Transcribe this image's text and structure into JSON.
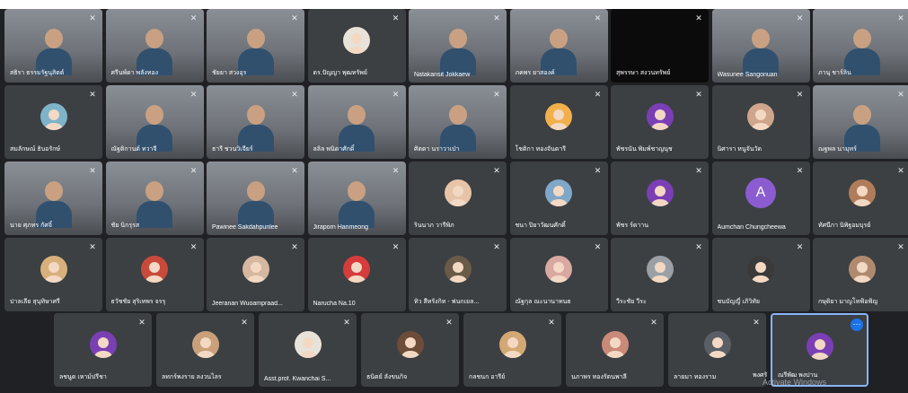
{
  "meeting": {
    "grid_rows": [
      [
        {
          "name": "สธิรา ธรรมรัฐนุสิตต์",
          "type": "video"
        },
        {
          "name": "ศรีนพ์ดา พลังทอง",
          "type": "video"
        },
        {
          "name": "ชัยยา สวงอุร",
          "type": "video"
        },
        {
          "name": "ดร.ปัญญา พุฒทรัพย์",
          "type": "avatar",
          "avatar_color": "#e8e3d8"
        },
        {
          "name": "Natakansit Jokkaew",
          "type": "video"
        },
        {
          "name": "ภคพร ยาสองค์",
          "type": "video"
        },
        {
          "name": "สุพรรษา สงวนทรัพย์",
          "type": "black"
        },
        {
          "name": "Wasunee Sangonuan",
          "type": "video"
        },
        {
          "name": "ภานุ ชาร์ลิน",
          "type": "video"
        }
      ],
      [
        {
          "name": "สมลักษณ์ ธิบอรักษ์",
          "type": "avatar",
          "avatar_color": "#7fb3c8"
        },
        {
          "name": "ณัฐติกานต์ ทวาจี",
          "type": "video"
        },
        {
          "name": "ธารี ชวนวิเจียร์",
          "type": "video"
        },
        {
          "name": "ลลิล พนิดาศักดิ์",
          "type": "video"
        },
        {
          "name": "ศิตดา นราวาเป่า",
          "type": "video"
        },
        {
          "name": "โชติกา ทองจันดารี",
          "type": "avatar",
          "avatar_color": "#f2b04a"
        },
        {
          "name": "พัชรนัน พิมพ์ชาญนุช",
          "type": "avatar",
          "avatar_color": "#7b3fb5"
        },
        {
          "name": "นิศารา หนูจันวัด",
          "type": "avatar",
          "avatar_color": "#cfa58b"
        },
        {
          "name": "ณฐพล นามุทร์",
          "type": "video"
        }
      ],
      [
        {
          "name": "นาย ศุภทร กัศจิ์",
          "type": "video"
        },
        {
          "name": "ชัย นิกรุรส",
          "type": "video"
        },
        {
          "name": "Pawinee Sakdahpunlee",
          "type": "video"
        },
        {
          "name": "Jiraporn Hanmeong",
          "type": "video"
        },
        {
          "name": "รินนาภ วารีพิภ",
          "type": "avatar",
          "avatar_color": "#e7c4a8"
        },
        {
          "name": "ชนา ปิยาวัฒนศักดิ์",
          "type": "avatar",
          "avatar_color": "#7fa7c8"
        },
        {
          "name": "พัชร ร์ดาาน",
          "type": "avatar",
          "avatar_color": "#7b3fb5"
        },
        {
          "name": "Aumchan Chungcheewa",
          "type": "letter",
          "letter": "A",
          "avatar_color": "#8a5cd0"
        },
        {
          "name": "ทัศนีกา นิพิฐอมบุรย์",
          "type": "avatar",
          "avatar_color": "#b07c5a"
        }
      ],
      [
        {
          "name": "ปาลเลีย สุนุทิษาศรี",
          "type": "avatar",
          "avatar_color": "#d8b07c"
        },
        {
          "name": "ธวัชชัย สุริเทพร จรรุ",
          "type": "avatar",
          "avatar_color": "#c94a3a"
        },
        {
          "name": "Jeeranan Wuoampraad...",
          "type": "avatar",
          "avatar_color": "#d6b8a0"
        },
        {
          "name": "Narucha Na.10",
          "type": "avatar",
          "avatar_color": "#d63c3c"
        },
        {
          "name": "ทิว สีทรังกิท - ฟนกเยล...",
          "type": "avatar",
          "avatar_color": "#6a5a48"
        },
        {
          "name": "ณัฐกุล ณะนานาทนธ",
          "type": "avatar",
          "avatar_color": "#d9a8a0"
        },
        {
          "name": "วีระชัย วีระ",
          "type": "avatar",
          "avatar_color": "#9aa0a6"
        },
        {
          "name": "ชนบัญญี่ เภิวิทัย",
          "type": "avatar",
          "avatar_color": "#3a3a3a"
        },
        {
          "name": "กษุดิยา มาญโหฟ้อฟ้ญ",
          "type": "avatar",
          "avatar_color": "#b08a6e"
        }
      ]
    ],
    "bottom_row": [
      {
        "name": "ลชนูด เหาม์ปรีชา",
        "type": "avatar",
        "avatar_color": "#7b3fb5"
      },
      {
        "name": "ลทกร์พงราย ลงวนไลร",
        "type": "avatar",
        "avatar_color": "#c9a07a"
      },
      {
        "name": "Asst.prof. Kwanchai S...",
        "type": "avatar",
        "avatar_color": "#e8e3d8"
      },
      {
        "name": "ธนิตย์ ลังขนกิจ",
        "type": "avatar",
        "avatar_color": "#6d4c3a"
      },
      {
        "name": "กลชนก อารีย์",
        "type": "avatar",
        "avatar_color": "#d4a874"
      },
      {
        "name": "นภาพร ทองรัตนพาลี",
        "type": "avatar",
        "avatar_color": "#c98a7a"
      },
      {
        "name": "ลายมา ทองราม",
        "type": "avatar",
        "avatar_color": "#5a5f66"
      },
      {
        "name": "ณรีพัฒ พงปาน",
        "type": "avatar",
        "avatar_color": "#7b3fb5",
        "active": true
      }
    ],
    "bottom_row_partial_label": "พงศรั",
    "more_options_glyph": "⋯",
    "mic_glyph": "✕",
    "watermark": "Activate Windows"
  }
}
